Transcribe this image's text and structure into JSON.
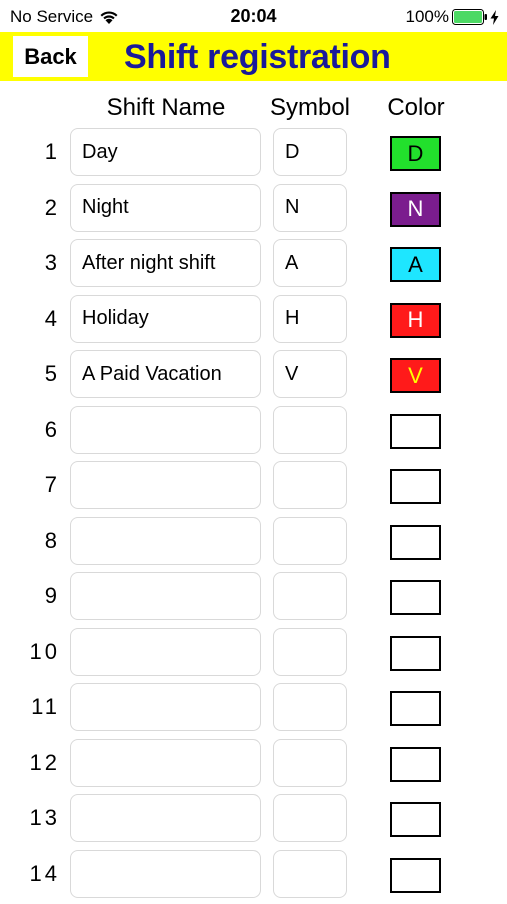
{
  "status_bar": {
    "carrier": "No Service",
    "time": "20:04",
    "battery": "100%",
    "battery_color": "#4cd964"
  },
  "header": {
    "back_label": "Back",
    "title": "Shift registration",
    "background": "#ffff00",
    "title_color": "#1a1a9a"
  },
  "columns": {
    "name": "Shift Name",
    "symbol": "Symbol",
    "color": "Color"
  },
  "rows": [
    {
      "number": "1",
      "name": "Day",
      "symbol": "D",
      "swatch_bg": "#22e02c",
      "swatch_text": "D",
      "swatch_text_color": "#000000"
    },
    {
      "number": "2",
      "name": "Night",
      "symbol": "N",
      "swatch_bg": "#7b1d8e",
      "swatch_text": "N",
      "swatch_text_color": "#ffffff"
    },
    {
      "number": "3",
      "name": "After night shift",
      "symbol": "A",
      "swatch_bg": "#1ee6ff",
      "swatch_text": "A",
      "swatch_text_color": "#000000"
    },
    {
      "number": "4",
      "name": "Holiday",
      "symbol": "H",
      "swatch_bg": "#ff1a1a",
      "swatch_text": "H",
      "swatch_text_color": "#ffffff"
    },
    {
      "number": "5",
      "name": "A Paid Vacation",
      "symbol": "V",
      "swatch_bg": "#ff1a1a",
      "swatch_text": "V",
      "swatch_text_color": "#ffff00"
    },
    {
      "number": "6",
      "name": "",
      "symbol": "",
      "swatch_bg": "#ffffff",
      "swatch_text": "",
      "swatch_text_color": "#000000"
    },
    {
      "number": "7",
      "name": "",
      "symbol": "",
      "swatch_bg": "#ffffff",
      "swatch_text": "",
      "swatch_text_color": "#000000"
    },
    {
      "number": "8",
      "name": "",
      "symbol": "",
      "swatch_bg": "#ffffff",
      "swatch_text": "",
      "swatch_text_color": "#000000"
    },
    {
      "number": "9",
      "name": "",
      "symbol": "",
      "swatch_bg": "#ffffff",
      "swatch_text": "",
      "swatch_text_color": "#000000"
    },
    {
      "number": "10",
      "name": "",
      "symbol": "",
      "swatch_bg": "#ffffff",
      "swatch_text": "",
      "swatch_text_color": "#000000"
    },
    {
      "number": "11",
      "name": "",
      "symbol": "",
      "swatch_bg": "#ffffff",
      "swatch_text": "",
      "swatch_text_color": "#000000"
    },
    {
      "number": "12",
      "name": "",
      "symbol": "",
      "swatch_bg": "#ffffff",
      "swatch_text": "",
      "swatch_text_color": "#000000"
    },
    {
      "number": "13",
      "name": "",
      "symbol": "",
      "swatch_bg": "#ffffff",
      "swatch_text": "",
      "swatch_text_color": "#000000"
    },
    {
      "number": "14",
      "name": "",
      "symbol": "",
      "swatch_bg": "#ffffff",
      "swatch_text": "",
      "swatch_text_color": "#000000"
    }
  ]
}
